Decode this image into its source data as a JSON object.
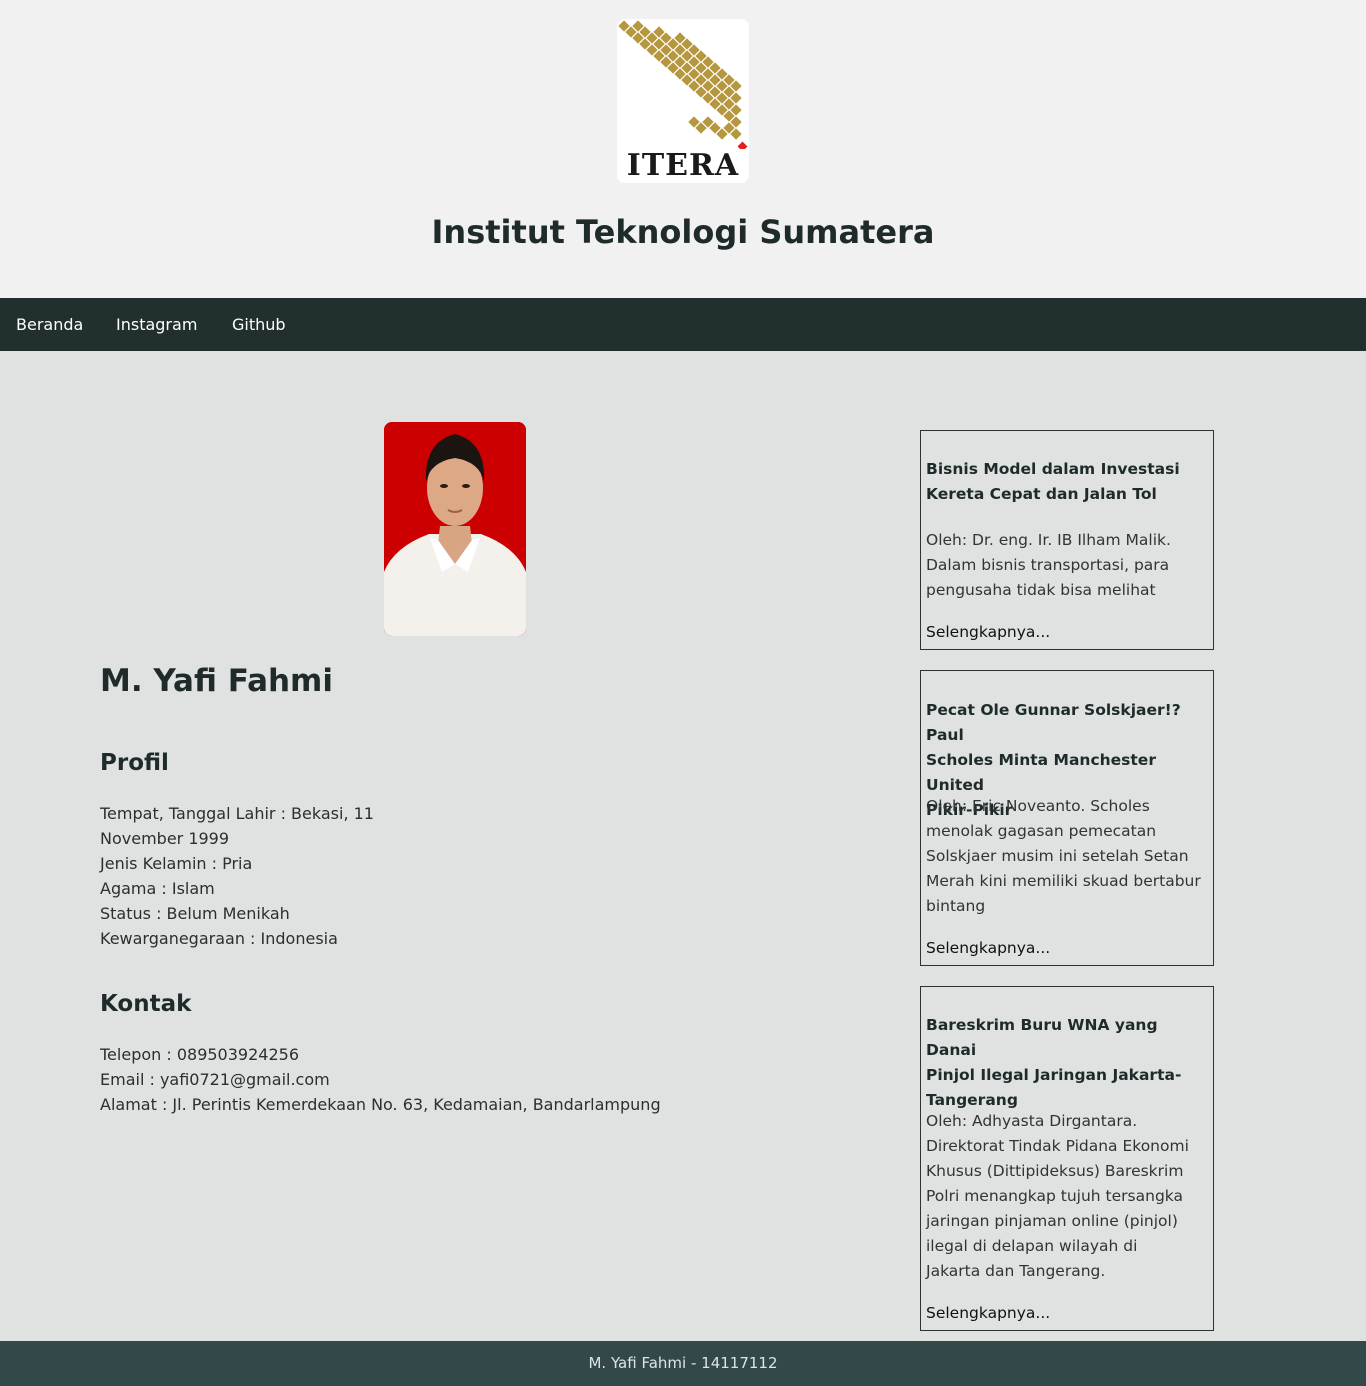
{
  "header": {
    "logo_text": "ITERA",
    "site_title": "Institut Teknologi Sumatera"
  },
  "nav": {
    "items": [
      "Beranda",
      "Instagram",
      "Github"
    ]
  },
  "profile": {
    "name": "M. Yafi Fahmi",
    "profil_title": "Profil",
    "profil_lines": [
      "Tempat, Tanggal Lahir : Bekasi, 11",
      "November 1999",
      "Jenis Kelamin : Pria",
      "Agama : Islam",
      "Status : Belum Menikah",
      "Kewarganegaraan : Indonesia"
    ],
    "kontak_title": "Kontak",
    "kontak_lines": [
      "Telepon : 089503924256",
      "Email : yafi0721@gmail.com",
      "Alamat : Jl. Perintis Kemerdekaan No. 63, Kedamaian, Bandarlampung"
    ]
  },
  "articles": [
    {
      "title_lines": [
        "Bisnis Model dalam Investasi",
        "Kereta Cepat dan Jalan Tol"
      ],
      "body_lines": [
        "Oleh: Dr. eng. Ir. IB Ilham Malik.",
        "Dalam bisnis transportasi, para",
        "pengusaha tidak bisa melihat"
      ],
      "more": "Selengkapnya..."
    },
    {
      "title_lines": [
        "Pecat Ole Gunnar Solskjaer!? Paul",
        "Scholes Minta Manchester United",
        "Pikir-Pikir"
      ],
      "body_lines": [
        "Oleh: Eric Noveanto. Scholes",
        "menolak gagasan pemecatan",
        "Solskjaer musim ini setelah Setan",
        "Merah kini memiliki skuad bertabur",
        "bintang"
      ],
      "more": "Selengkapnya..."
    },
    {
      "title_lines": [
        "Bareskrim Buru WNA yang Danai",
        "Pinjol Ilegal Jaringan Jakarta-",
        "Tangerang"
      ],
      "body_lines": [
        "Oleh: Adhyasta Dirgantara.",
        "Direktorat Tindak Pidana Ekonomi",
        "Khusus (Dittipideksus) Bareskrim",
        "Polri menangkap tujuh tersangka",
        "jaringan pinjaman online (pinjol)",
        "ilegal di delapan wilayah di",
        "Jakarta dan Tangerang."
      ],
      "more": "Selengkapnya..."
    }
  ],
  "footer": {
    "text": "M. Yafi Fahmi - 14117112"
  },
  "colors": {
    "nav_bg": "#222f2f",
    "footer_bg": "#334848",
    "page_bg": "#dfe2e1",
    "header_bg": "#f1f1f1",
    "logo_gold": "#b5973f",
    "logo_red": "#e02020",
    "photo_bg": "#cc0000"
  }
}
